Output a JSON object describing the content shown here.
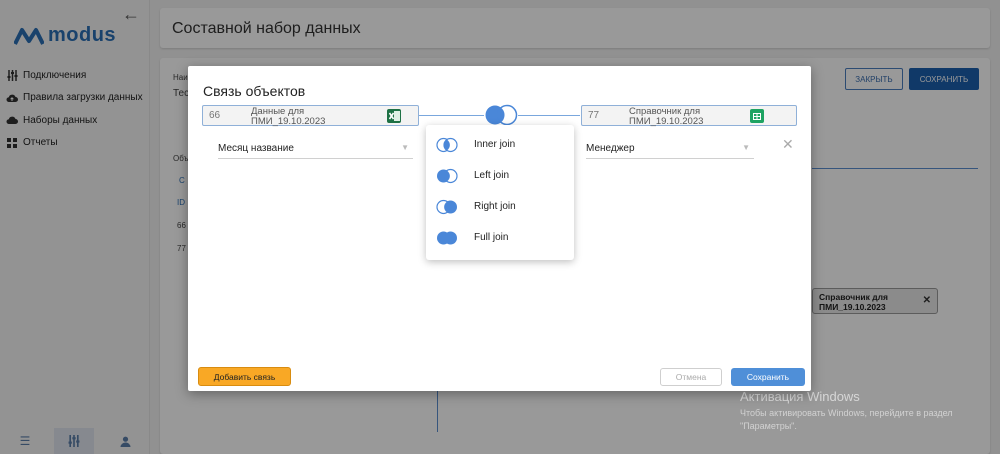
{
  "sidebar": {
    "back_icon": "arrow-left-icon",
    "logo_text": "modus",
    "items": [
      {
        "label": "Подключения",
        "icon": "sliders-icon"
      },
      {
        "label": "Правила загрузки данных",
        "icon": "cloud-upload-icon"
      },
      {
        "label": "Наборы данных",
        "icon": "cloud-icon"
      },
      {
        "label": "Отчеты",
        "icon": "grid-icon"
      }
    ],
    "bottom_icons": [
      "menu-icon",
      "sliders-icon",
      "user-icon"
    ]
  },
  "page": {
    "title": "Составной набор данных",
    "close_label": "ЗАКРЫТЬ",
    "save_label": "СОХРАНИТЬ",
    "chip_label": "Справочник для ПМИ_19.10.2023",
    "fragments": [
      "Наи",
      "Тес",
      "Объ",
      "С",
      "ID",
      "66",
      "77"
    ]
  },
  "modal": {
    "title": "Связь объектов",
    "left_object": {
      "id": "66",
      "name": "Данные для ПМИ_19.10.2023",
      "icon": "excel-icon"
    },
    "right_object": {
      "id": "77",
      "name": "Справочник для ПМИ_19.10.2023",
      "icon": "sheets-icon"
    },
    "left_field": "Месяц название",
    "right_field": "Менеджер",
    "join_menu": [
      {
        "label": "Inner join",
        "type": "inner"
      },
      {
        "label": "Left join",
        "type": "left"
      },
      {
        "label": "Right join",
        "type": "right"
      },
      {
        "label": "Full join",
        "type": "full"
      }
    ],
    "add_link_label": "Добавить связь",
    "cancel_label": "Отмена",
    "save_label": "Сохранить"
  },
  "watermark": {
    "title": "Активация Windows",
    "line1": "Чтобы активировать Windows, перейдите в раздел",
    "line2": "\"Параметры\"."
  },
  "colors": {
    "accent": "#4f8fd8",
    "primary_dark": "#1b5fad",
    "add_button": "#f9a825"
  }
}
